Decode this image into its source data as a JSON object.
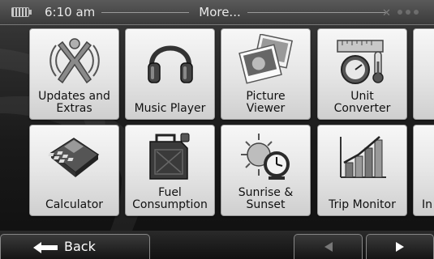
{
  "status_bar": {
    "time": "6:10 am",
    "title": "More..."
  },
  "tiles": [
    {
      "label": "Updates and\nExtras",
      "icon": "updates-extras-icon"
    },
    {
      "label": "Music Player",
      "icon": "headphones-icon"
    },
    {
      "label": "Picture\nViewer",
      "icon": "pictures-icon"
    },
    {
      "label": "Unit\nConverter",
      "icon": "unit-converter-icon"
    },
    {
      "label": "Calculator",
      "icon": "calculator-icon"
    },
    {
      "label": "Fuel\nConsumption",
      "icon": "fuel-can-icon"
    },
    {
      "label": "Sunrise &\nSunset",
      "icon": "sunrise-sunset-icon"
    },
    {
      "label": "Trip Monitor",
      "icon": "trip-monitor-icon"
    },
    {
      "label": "In",
      "icon": ""
    }
  ],
  "nav": {
    "back_label": "Back"
  }
}
